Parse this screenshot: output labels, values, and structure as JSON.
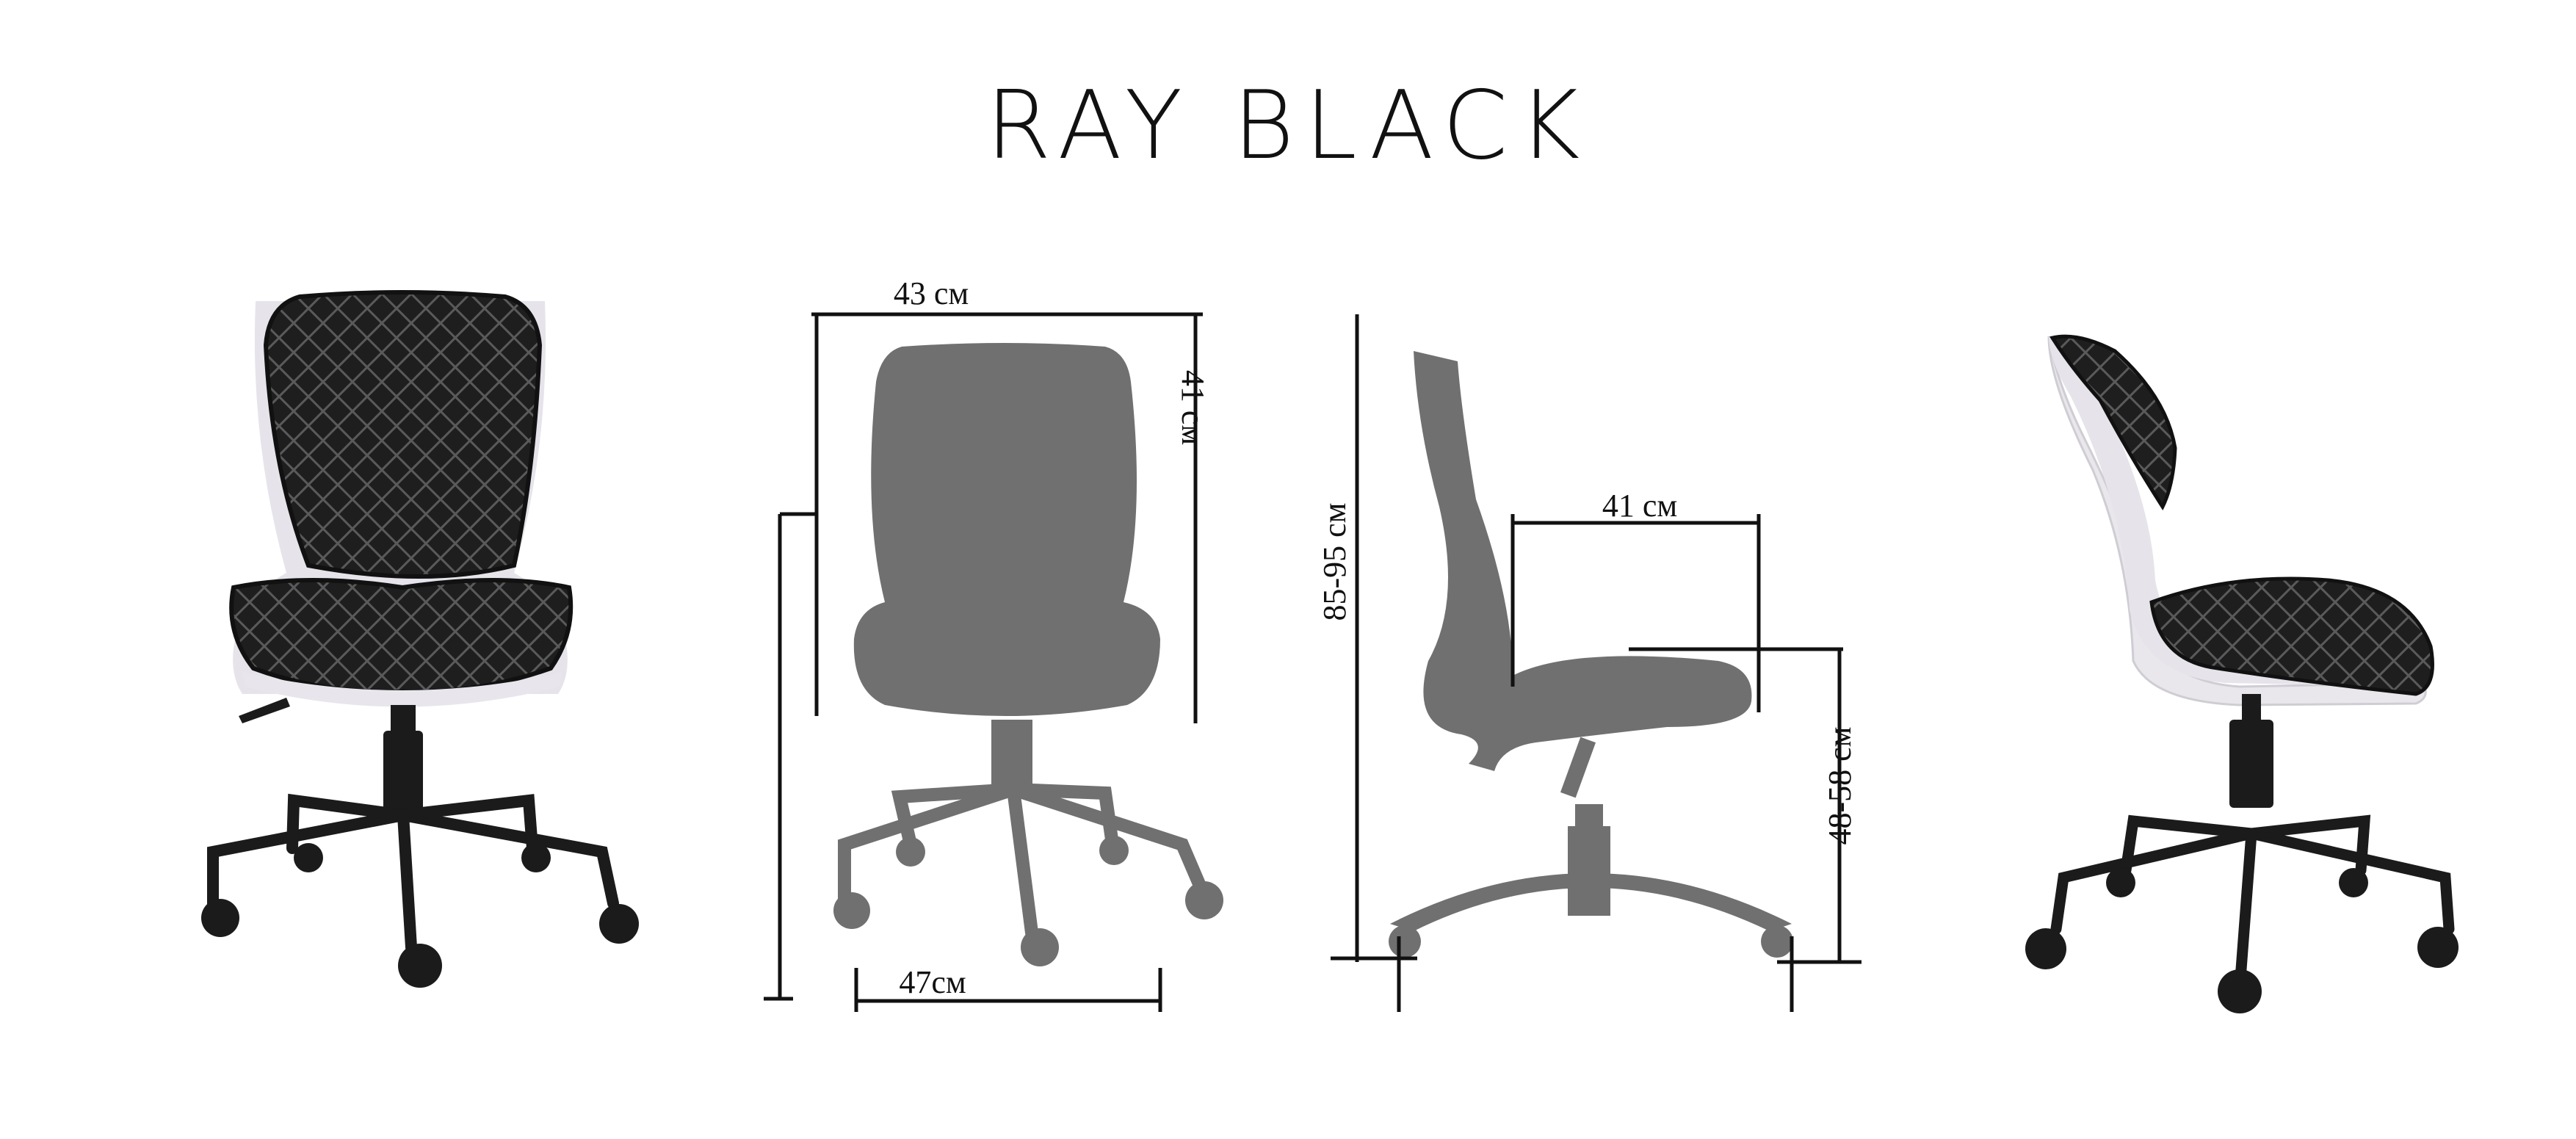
{
  "title": "RAY BLACK",
  "dimensions": {
    "front_width": "43 см",
    "backrest_height": "41 см",
    "base_width": "47см",
    "seat_depth": "41 см",
    "total_height": "85-95 см",
    "seat_height": "48-58 см"
  },
  "colors": {
    "upholstery": "#1b1b1b",
    "shell_white": "#e9e7ec",
    "silhouette": "#707070",
    "dimension_lines": "#111111"
  }
}
